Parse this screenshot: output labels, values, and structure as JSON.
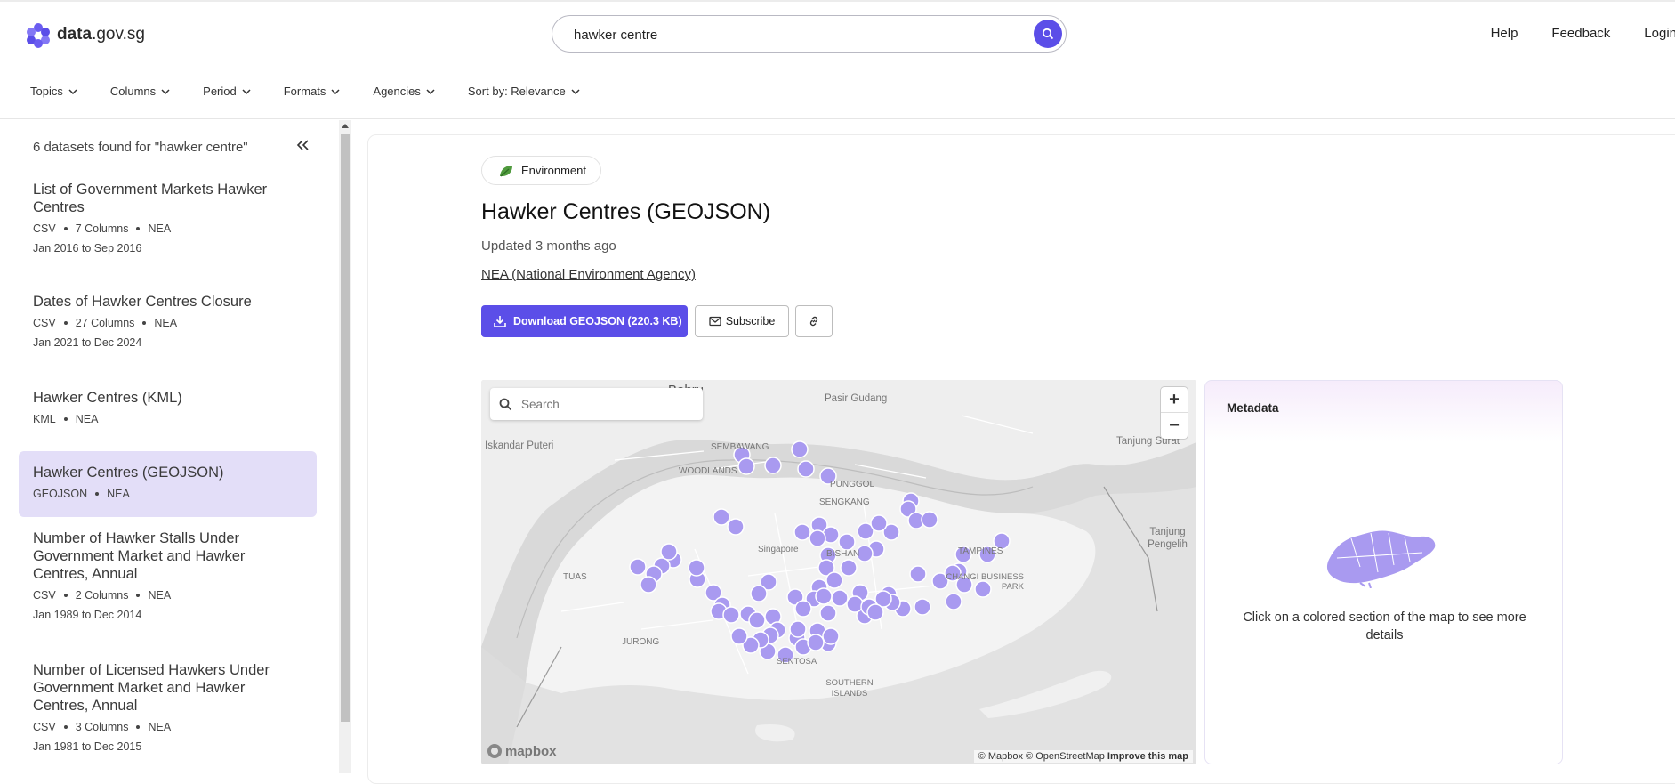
{
  "header": {
    "logo": {
      "bold": "data",
      "rest": ".gov.sg"
    },
    "search_value": "hawker centre",
    "links": [
      "Help",
      "Feedback",
      "Login"
    ]
  },
  "filters": [
    "Topics",
    "Columns",
    "Period",
    "Formats",
    "Agencies",
    "Sort by: Relevance"
  ],
  "sidebar": {
    "results_text": "6 datasets found for \"hawker centre\"",
    "datasets": [
      {
        "title": "List of Government Markets Hawker Centres",
        "meta": [
          "CSV",
          "7 Columns",
          "NEA"
        ],
        "dates": "Jan 2016 to Sep 2016"
      },
      {
        "title": "Dates of Hawker Centres Closure",
        "meta": [
          "CSV",
          "27 Columns",
          "NEA"
        ],
        "dates": "Jan 2021 to Dec 2024"
      },
      {
        "title": "Hawker Centres (KML)",
        "meta": [
          "KML",
          "NEA"
        ],
        "dates": ""
      },
      {
        "title": "Hawker Centres (GEOJSON)",
        "meta": [
          "GEOJSON",
          "NEA"
        ],
        "dates": "",
        "active": true
      },
      {
        "title": "Number of Hawker Stalls Under Government Market and Hawker Centres, Annual",
        "meta": [
          "CSV",
          "2 Columns",
          "NEA"
        ],
        "dates": "Jan 1989 to Dec 2014"
      },
      {
        "title": "Number of Licensed Hawkers Under Government Market and Hawker Centres, Annual",
        "meta": [
          "CSV",
          "3 Columns",
          "NEA"
        ],
        "dates": "Jan 1981 to Dec 2015"
      }
    ]
  },
  "detail": {
    "topic": "Environment",
    "title": "Hawker Centres (GEOJSON)",
    "updated": "Updated 3 months ago",
    "agency": "NEA (National Environment Agency)",
    "download_label": "Download GEOJSON (220.3 KB)",
    "subscribe_label": "Subscribe"
  },
  "map": {
    "search_placeholder": "Search",
    "zoom_in": "+",
    "zoom_out": "−",
    "attribution": {
      "mapbox": "© Mapbox",
      "osm": "© OpenStreetMap",
      "improve": "Improve this map"
    },
    "logo": "mapbox",
    "places": {
      "bahru": "Bahru",
      "pasir_gudang": "Pasir Gudang",
      "iskandar_puteri": "Iskandar Puteri",
      "tanjung_surat": "Tanjung Surat",
      "sembawang": "SEMBAWANG",
      "woodlands": "WOODLANDS",
      "punggol": "PUNGGOL",
      "sengkang": "SENGKANG",
      "singapore": "Singapore",
      "bishan": "BISHAN",
      "tampines": "TAMPINES",
      "changi_business_park": "CHANGI BUSINESS PARK",
      "tanjung_pengelih": "Tanjung Pengelih",
      "tuas": "TUAS",
      "jurong": "JURONG",
      "sentosa": "SENTOSA",
      "southern_islands": "SOUTHERN ISLANDS"
    },
    "marker_color": "#a99af0"
  },
  "metadata": {
    "title": "Metadata",
    "hint": "Click on a colored section of the map to see more details"
  },
  "colors": {
    "accent": "#5b4ee8",
    "active_bg": "#e3def8",
    "marker": "#a99af0"
  }
}
